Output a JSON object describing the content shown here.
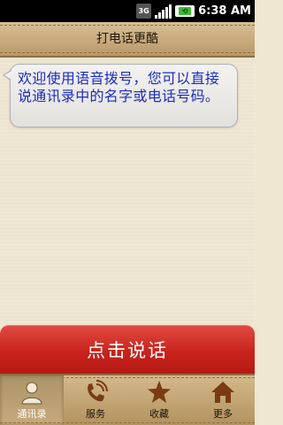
{
  "status_bar": {
    "network_label": "3G",
    "time": "6:38",
    "ampm": "AM"
  },
  "header": {
    "title": "打电话更酷"
  },
  "message": {
    "text": "欢迎使用语音拨号，您可以直接说通讯录中的名字或电话号码。"
  },
  "talk_button": {
    "label": "点击说话"
  },
  "nav": {
    "items": [
      {
        "label": "通讯录",
        "icon": "contact-person-icon"
      },
      {
        "label": "服务",
        "icon": "phone-call-icon"
      },
      {
        "label": "收藏",
        "icon": "star-icon"
      },
      {
        "label": "更多",
        "icon": "home-icon"
      }
    ],
    "active_index": 0
  },
  "colors": {
    "accent_red": "#c8231c",
    "tan": "#c9aa79",
    "message_text": "#1a2cc8",
    "icon_brown": "#7a3b12"
  }
}
